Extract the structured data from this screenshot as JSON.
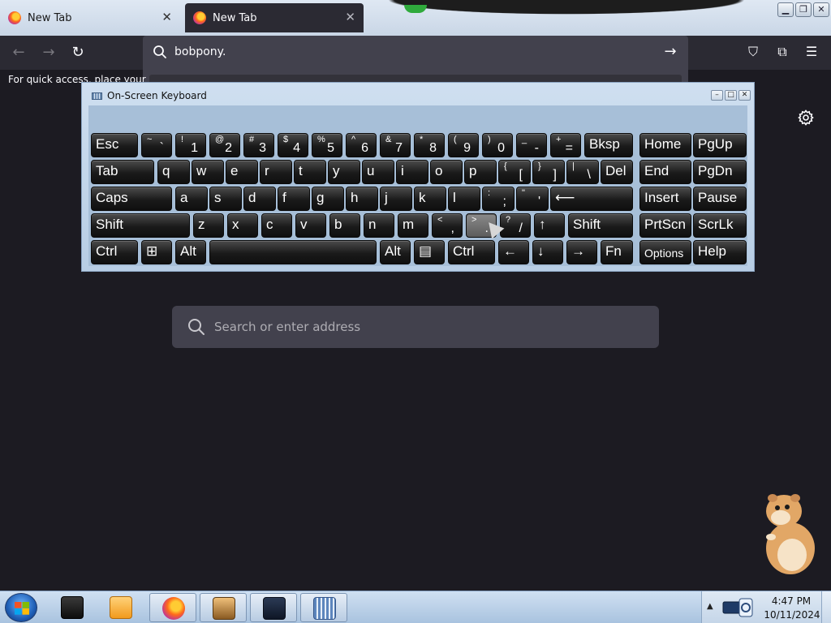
{
  "browser": {
    "tabs": [
      {
        "label": "New Tab",
        "close": "✕"
      },
      {
        "label": "New Tab",
        "close": "✕"
      }
    ],
    "window_controls": {
      "minimize": "▁",
      "restore": "❐",
      "close": "✕"
    },
    "nav": {
      "back": "←",
      "forward": "→",
      "reload": "↻",
      "go": "→"
    },
    "url_value": "bobpony.",
    "bookmarks_hint": "For quick access, place your bo",
    "toolbar_icons": [
      "pocket-icon",
      "extensions-icon",
      "menu-icon"
    ],
    "toolbar_glyphs": {
      "pocket": "⛉",
      "extensions": "⧉",
      "menu": "☰"
    }
  },
  "newtab": {
    "search_placeholder": "Search or enter address",
    "settings_icon": "gear-icon"
  },
  "osk": {
    "title": "On-Screen Keyboard",
    "controls": {
      "minimize": "–",
      "restore": "□",
      "close": "✕"
    },
    "rows": [
      [
        {
          "id": "esc",
          "label": "Esc"
        },
        {
          "id": "tilde",
          "sup": "~",
          "main": "`"
        },
        {
          "id": "1",
          "sup": "!",
          "main": "1"
        },
        {
          "id": "2",
          "sup": "@",
          "main": "2"
        },
        {
          "id": "3",
          "sup": "#",
          "main": "3"
        },
        {
          "id": "4",
          "sup": "$",
          "main": "4"
        },
        {
          "id": "5",
          "sup": "%",
          "main": "5"
        },
        {
          "id": "6",
          "sup": "^",
          "main": "6"
        },
        {
          "id": "7",
          "sup": "&",
          "main": "7"
        },
        {
          "id": "8",
          "sup": "*",
          "main": "8"
        },
        {
          "id": "9",
          "sup": "(",
          "main": "9"
        },
        {
          "id": "0",
          "sup": ")",
          "main": "0"
        },
        {
          "id": "minus",
          "sup": "_",
          "main": "-"
        },
        {
          "id": "equals",
          "sup": "+",
          "main": "="
        },
        {
          "id": "bksp",
          "label": "Bksp"
        },
        {
          "id": "home",
          "label": "Home"
        },
        {
          "id": "pgup",
          "label": "PgUp"
        }
      ],
      [
        {
          "id": "tab",
          "label": "Tab"
        },
        {
          "id": "q",
          "label": "q"
        },
        {
          "id": "w",
          "label": "w"
        },
        {
          "id": "e",
          "label": "e"
        },
        {
          "id": "r",
          "label": "r"
        },
        {
          "id": "t",
          "label": "t"
        },
        {
          "id": "y",
          "label": "y"
        },
        {
          "id": "u",
          "label": "u"
        },
        {
          "id": "i",
          "label": "i"
        },
        {
          "id": "o",
          "label": "o"
        },
        {
          "id": "p",
          "label": "p"
        },
        {
          "id": "lbracket",
          "sup": "{",
          "main": "["
        },
        {
          "id": "rbracket",
          "sup": "}",
          "main": "]"
        },
        {
          "id": "backslash",
          "sup": "|",
          "main": "\\"
        },
        {
          "id": "del",
          "label": "Del"
        },
        {
          "id": "end",
          "label": "End"
        },
        {
          "id": "pgdn",
          "label": "PgDn"
        }
      ],
      [
        {
          "id": "caps",
          "label": "Caps"
        },
        {
          "id": "a",
          "label": "a"
        },
        {
          "id": "s",
          "label": "s"
        },
        {
          "id": "d",
          "label": "d"
        },
        {
          "id": "f",
          "label": "f"
        },
        {
          "id": "g",
          "label": "g"
        },
        {
          "id": "h",
          "label": "h"
        },
        {
          "id": "j",
          "label": "j"
        },
        {
          "id": "k",
          "label": "k"
        },
        {
          "id": "l",
          "label": "l"
        },
        {
          "id": "semicolon",
          "sup": ":",
          "main": ";"
        },
        {
          "id": "quote",
          "sup": "\"",
          "main": "'"
        },
        {
          "id": "enter",
          "label": "⟵"
        },
        {
          "id": "insert",
          "label": "Insert"
        },
        {
          "id": "pause",
          "label": "Pause"
        }
      ],
      [
        {
          "id": "lshift",
          "label": "Shift"
        },
        {
          "id": "z",
          "label": "z"
        },
        {
          "id": "x",
          "label": "x"
        },
        {
          "id": "c",
          "label": "c"
        },
        {
          "id": "v",
          "label": "v"
        },
        {
          "id": "b",
          "label": "b"
        },
        {
          "id": "n",
          "label": "n"
        },
        {
          "id": "m",
          "label": "m"
        },
        {
          "id": "comma",
          "sup": "<",
          "main": ","
        },
        {
          "id": "period",
          "sup": ">",
          "main": "."
        },
        {
          "id": "slash",
          "sup": "?",
          "main": "/"
        },
        {
          "id": "up",
          "label": "↑"
        },
        {
          "id": "rshift",
          "label": "Shift"
        },
        {
          "id": "prtscn",
          "label": "PrtScn"
        },
        {
          "id": "scrlk",
          "label": "ScrLk"
        }
      ],
      [
        {
          "id": "lctrl",
          "label": "Ctrl"
        },
        {
          "id": "win",
          "label": "⊞"
        },
        {
          "id": "lalt",
          "label": "Alt"
        },
        {
          "id": "space",
          "label": ""
        },
        {
          "id": "ralt",
          "label": "Alt"
        },
        {
          "id": "menu",
          "label": "▤"
        },
        {
          "id": "rctrl",
          "label": "Ctrl"
        },
        {
          "id": "left",
          "label": "←"
        },
        {
          "id": "down",
          "label": "↓"
        },
        {
          "id": "right",
          "label": "→"
        },
        {
          "id": "fn",
          "label": "Fn"
        },
        {
          "id": "options",
          "label": "Options"
        },
        {
          "id": "help",
          "label": "Help"
        }
      ]
    ],
    "pressed_key": "period"
  },
  "taskbar": {
    "apps": [
      "cmd-icon",
      "media-player-icon",
      "firefox-icon",
      "hamster-box-icon",
      "remote-desktop-icon",
      "on-screen-keyboard-icon"
    ],
    "tray_arrow": "▲",
    "clock_time": "4:47 PM",
    "clock_date": "10/11/2024"
  }
}
